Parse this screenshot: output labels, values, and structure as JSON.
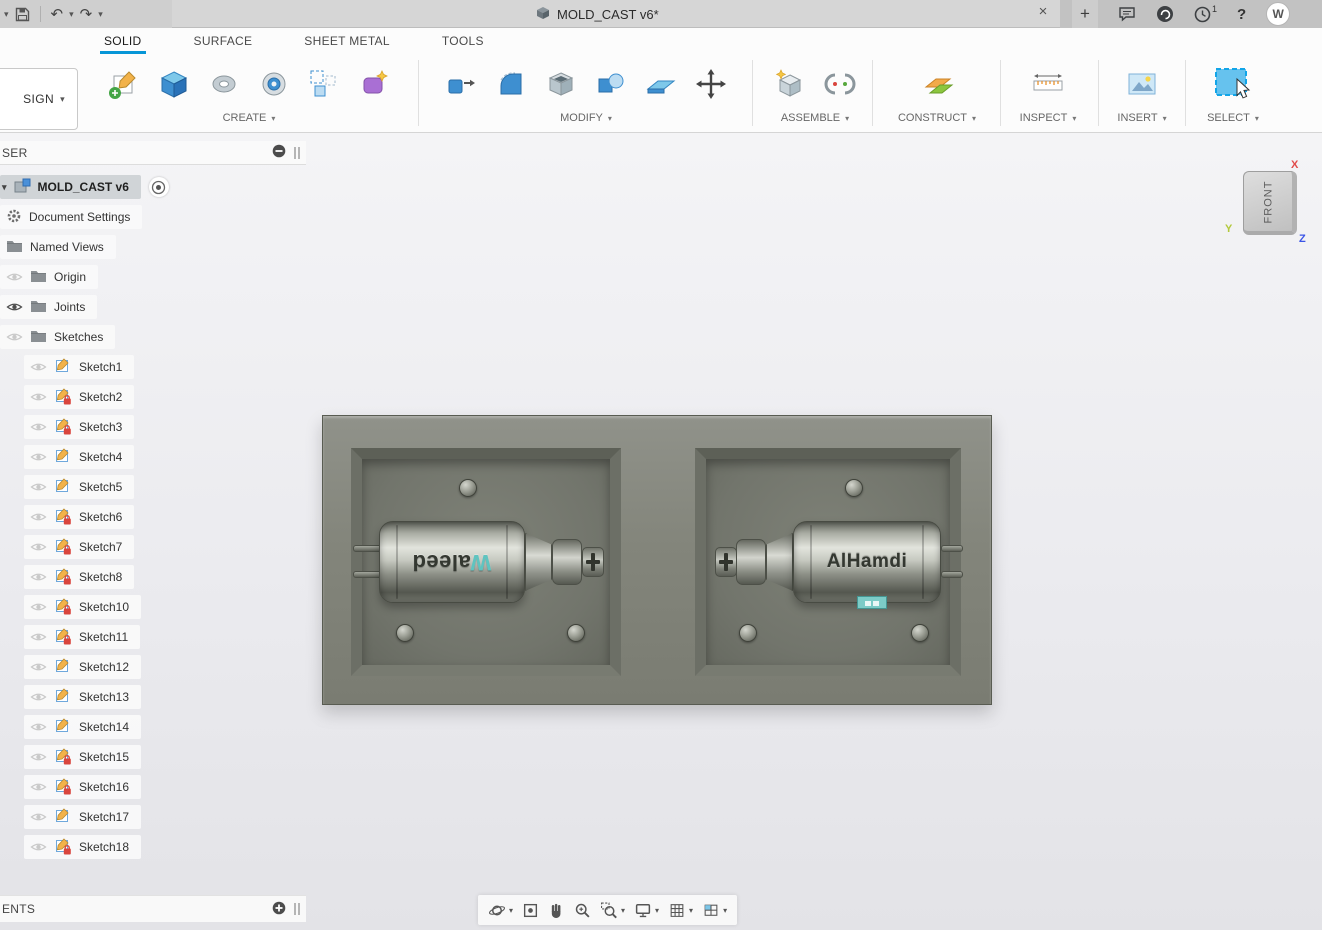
{
  "icons": {
    "caret_down": "▾",
    "undo": "↶",
    "redo": "↷",
    "close": "×",
    "plus": "+",
    "help": "?"
  },
  "titlebar": {
    "title": "MOLD_CAST v6*",
    "job_badge": "1",
    "avatar_initial": "W"
  },
  "ribbon": {
    "design_button": "SIGN",
    "active_tab": "SOLID",
    "tabs": [
      {
        "label": "SOLID"
      },
      {
        "label": "SURFACE"
      },
      {
        "label": "SHEET METAL"
      },
      {
        "label": "TOOLS"
      }
    ],
    "groups": [
      {
        "label": "CREATE"
      },
      {
        "label": "MODIFY"
      },
      {
        "label": "ASSEMBLE"
      },
      {
        "label": "CONSTRUCT"
      },
      {
        "label": "INSPECT"
      },
      {
        "label": "INSERT"
      },
      {
        "label": "SELECT"
      }
    ]
  },
  "browser": {
    "header": "SER",
    "root_label": "MOLD_CAST v6",
    "items": [
      {
        "label": "Document Settings"
      },
      {
        "label": "Named Views"
      },
      {
        "label": "Origin"
      },
      {
        "label": "Joints"
      },
      {
        "label": "Sketches"
      }
    ],
    "sketches": [
      {
        "label": "Sketch1",
        "locked": false
      },
      {
        "label": "Sketch2",
        "locked": true
      },
      {
        "label": "Sketch3",
        "locked": true
      },
      {
        "label": "Sketch4",
        "locked": false
      },
      {
        "label": "Sketch5",
        "locked": false
      },
      {
        "label": "Sketch6",
        "locked": true
      },
      {
        "label": "Sketch7",
        "locked": true
      },
      {
        "label": "Sketch8",
        "locked": true
      },
      {
        "label": "Sketch10",
        "locked": true
      },
      {
        "label": "Sketch11",
        "locked": true
      },
      {
        "label": "Sketch12",
        "locked": false
      },
      {
        "label": "Sketch13",
        "locked": false
      },
      {
        "label": "Sketch14",
        "locked": false
      },
      {
        "label": "Sketch15",
        "locked": true
      },
      {
        "label": "Sketch16",
        "locked": true
      },
      {
        "label": "Sketch17",
        "locked": false
      },
      {
        "label": "Sketch18",
        "locked": true
      }
    ]
  },
  "viewport": {
    "viewcube_face": "FRONT",
    "axis_x": "X",
    "axis_y": "Y",
    "axis_z": "Z",
    "left_part_first": "W",
    "left_part_rest": "aleed",
    "right_part_text": "AlHamdi"
  },
  "comments": {
    "header": "ENTS"
  },
  "colors": {
    "accent": "#0696d7",
    "lock_red": "#d9453d",
    "teal": "#5fc4c0"
  }
}
